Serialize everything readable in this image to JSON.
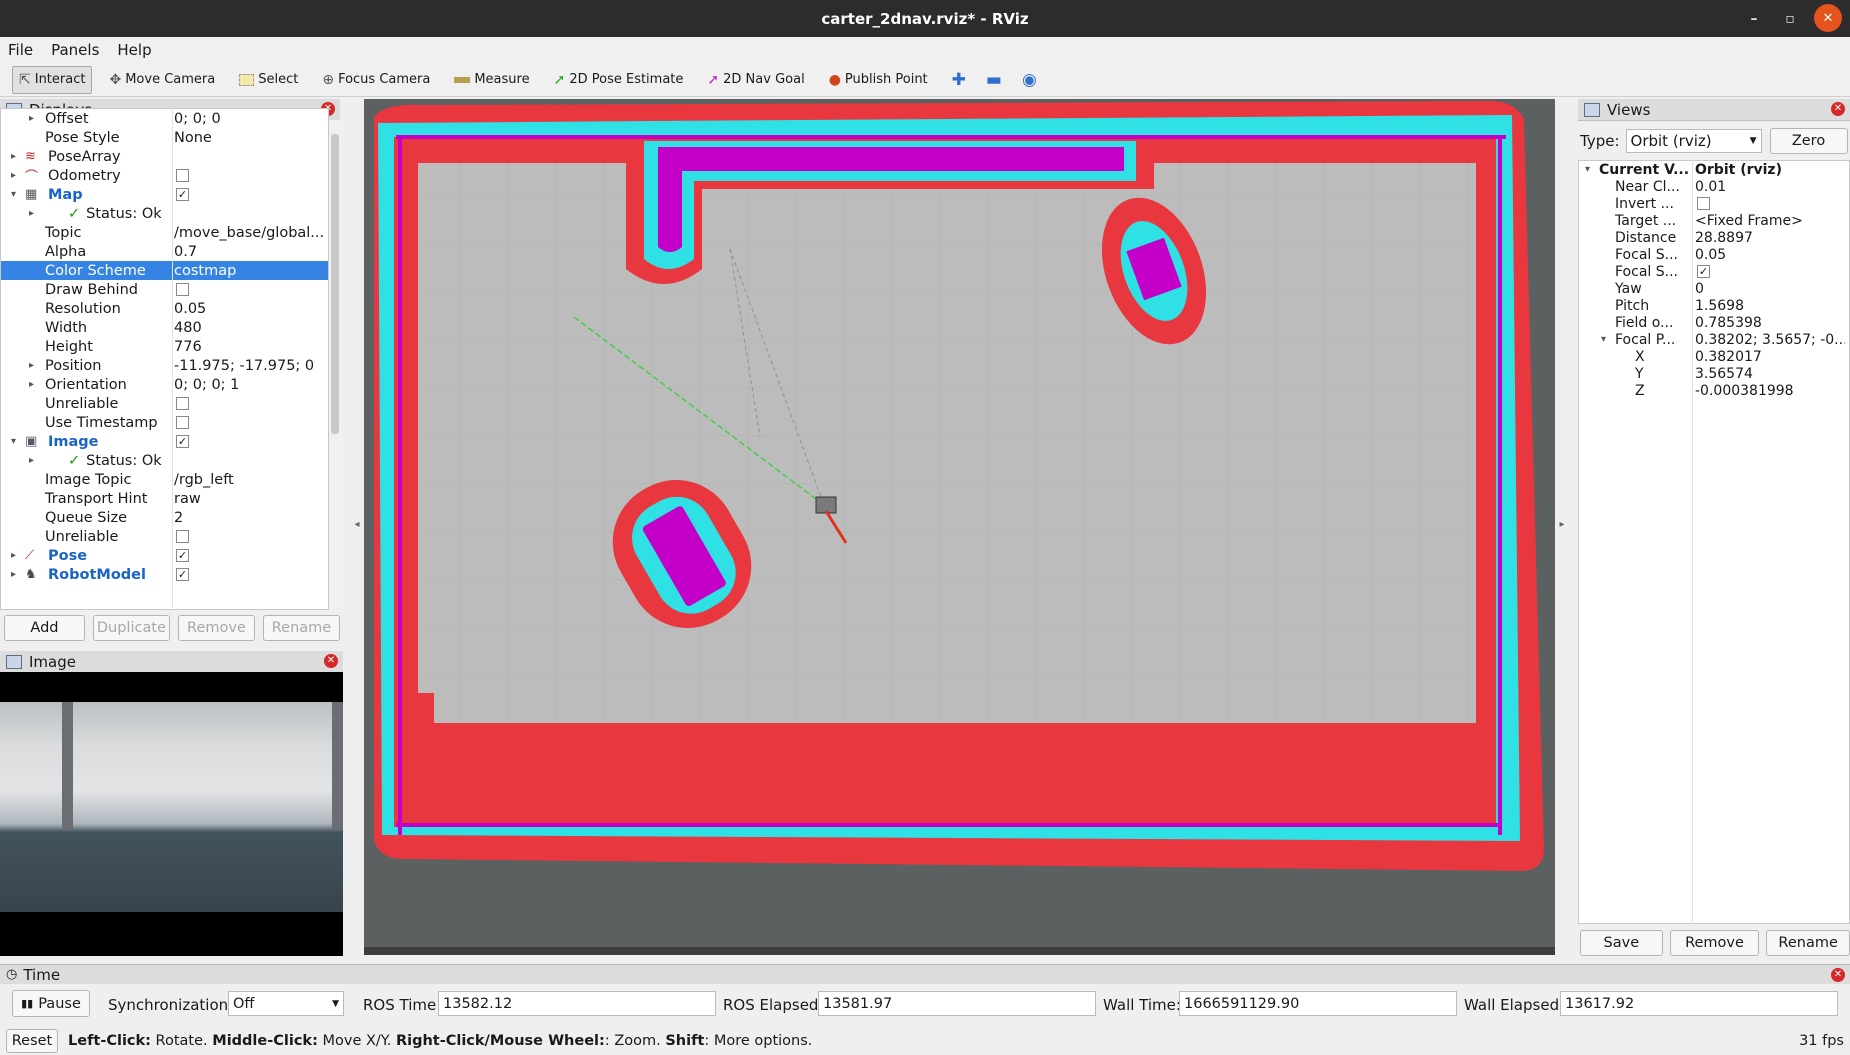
{
  "window": {
    "title": "carter_2dnav.rviz* - RViz",
    "min": "–",
    "max": "▫",
    "close": "✕"
  },
  "menu": [
    "File",
    "Panels",
    "Help"
  ],
  "toolbar": {
    "interact": "Interact",
    "move_camera": "Move Camera",
    "select": "Select",
    "focus_camera": "Focus Camera",
    "measure": "Measure",
    "pose_estimate": "2D Pose Estimate",
    "nav_goal": "2D Nav Goal",
    "publish_point": "Publish Point"
  },
  "displays": {
    "title": "Displays",
    "rows": [
      {
        "k": "Offset",
        "v": "0; 0; 0"
      },
      {
        "k": "Pose Style",
        "v": "None"
      },
      {
        "k": "PoseArray"
      },
      {
        "k": "Odometry"
      },
      {
        "k": "Map"
      },
      {
        "k": "Status: Ok"
      },
      {
        "k": "Topic",
        "v": "/move_base/global..."
      },
      {
        "k": "Alpha",
        "v": "0.7"
      },
      {
        "k": "Color Scheme",
        "v": "costmap"
      },
      {
        "k": "Draw Behind"
      },
      {
        "k": "Resolution",
        "v": "0.05"
      },
      {
        "k": "Width",
        "v": "480"
      },
      {
        "k": "Height",
        "v": "776"
      },
      {
        "k": "Position",
        "v": "-11.975; -17.975; 0"
      },
      {
        "k": "Orientation",
        "v": "0; 0; 0; 1"
      },
      {
        "k": "Unreliable"
      },
      {
        "k": "Use Timestamp"
      },
      {
        "k": "Image"
      },
      {
        "k": "Status: Ok"
      },
      {
        "k": "Image Topic",
        "v": "/rgb_left"
      },
      {
        "k": "Transport Hint",
        "v": "raw"
      },
      {
        "k": "Queue Size",
        "v": "2"
      },
      {
        "k": "Unreliable"
      },
      {
        "k": "Pose"
      },
      {
        "k": "RobotModel"
      }
    ],
    "buttons": {
      "add": "Add",
      "duplicate": "Duplicate",
      "remove": "Remove",
      "rename": "Rename"
    }
  },
  "image_panel": {
    "title": "Image"
  },
  "views": {
    "title": "Views",
    "type_label": "Type:",
    "type_value": "Orbit (rviz)",
    "zero": "Zero",
    "rows": [
      {
        "k": "Current V...",
        "v": "Orbit (rviz)"
      },
      {
        "k": "Near Cl...",
        "v": "0.01"
      },
      {
        "k": "Invert ..."
      },
      {
        "k": "Target ...",
        "v": "<Fixed Frame>"
      },
      {
        "k": "Distance",
        "v": "28.8897"
      },
      {
        "k": "Focal S...",
        "v": "0.05"
      },
      {
        "k": "Focal S..."
      },
      {
        "k": "Yaw",
        "v": "0"
      },
      {
        "k": "Pitch",
        "v": "1.5698"
      },
      {
        "k": "Field o...",
        "v": "0.785398"
      },
      {
        "k": "Focal P...",
        "v": "0.38202; 3.5657; -0...."
      },
      {
        "k": "X",
        "v": "0.382017"
      },
      {
        "k": "Y",
        "v": "3.56574"
      },
      {
        "k": "Z",
        "v": "-0.000381998"
      }
    ],
    "buttons": {
      "save": "Save",
      "remove": "Remove",
      "rename": "Rename"
    }
  },
  "time": {
    "title": "Time",
    "pause": "Pause",
    "sync_label": "Synchronization:",
    "sync_value": "Off",
    "ros_time_label": "ROS Time:",
    "ros_time": "13582.12",
    "ros_elapsed_label": "ROS Elapsed:",
    "ros_elapsed": "13581.97",
    "wall_time_label": "Wall Time:",
    "wall_time": "1666591129.90",
    "wall_elapsed_label": "Wall Elapsed:",
    "wall_elapsed": "13617.92"
  },
  "status": {
    "reset": "Reset",
    "lc": "Left-Click:",
    "lc_t": " Rotate. ",
    "mc": "Middle-Click:",
    "mc_t": " Move X/Y. ",
    "rc": "Right-Click/Mouse Wheel:",
    "rc_t": ": Zoom. ",
    "sh": "Shift",
    "sh_t": ": More options.",
    "fps": "31 fps"
  },
  "colors": {
    "lethal": "#e8373f",
    "inflated": "#2fe0e4",
    "obstacle": "#c400c8",
    "free": "#bcbcbc",
    "selection": "#3584e4"
  }
}
